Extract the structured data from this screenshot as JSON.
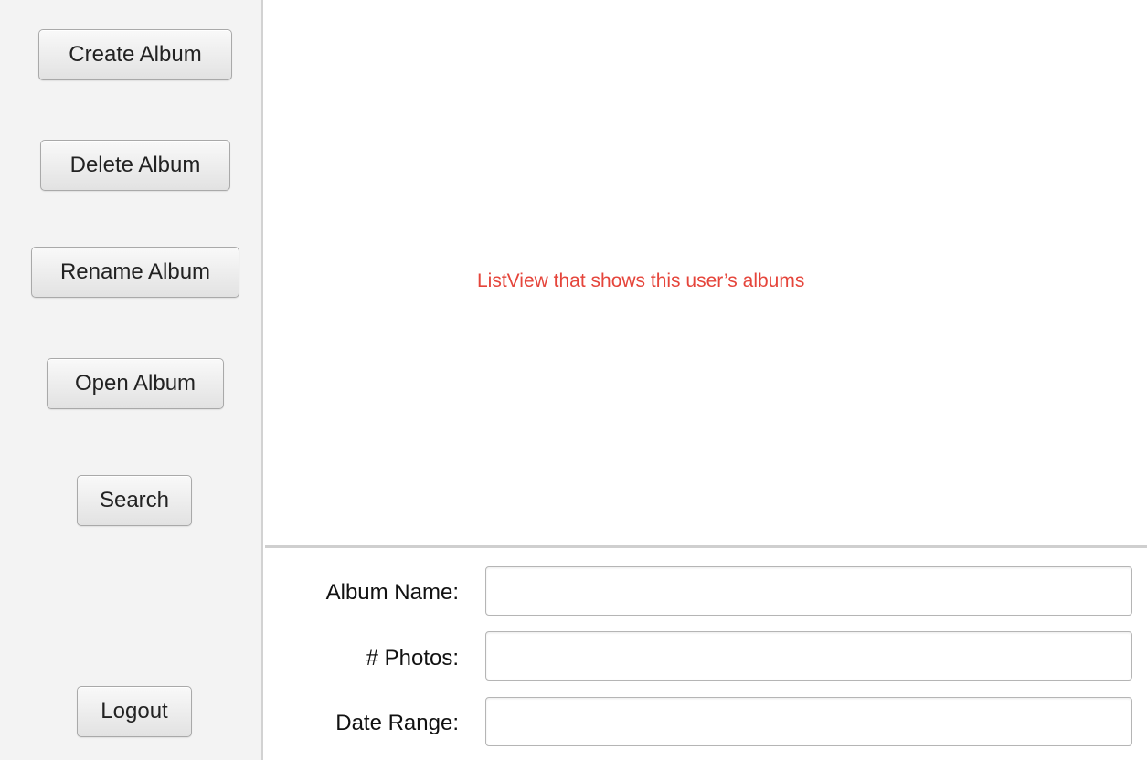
{
  "sidebar": {
    "buttons": {
      "create": "Create Album",
      "delete": "Delete Album",
      "rename": "Rename Album",
      "open": "Open Album",
      "search": "Search",
      "logout": "Logout"
    }
  },
  "album_list": {
    "placeholder_text": "ListView that shows this user’s albums",
    "placeholder_color": "#e5453b"
  },
  "details": {
    "album_name": {
      "label": "Album Name:",
      "value": ""
    },
    "photo_count": {
      "label": "# Photos:",
      "value": ""
    },
    "date_range": {
      "label": "Date Range:",
      "value": ""
    }
  }
}
